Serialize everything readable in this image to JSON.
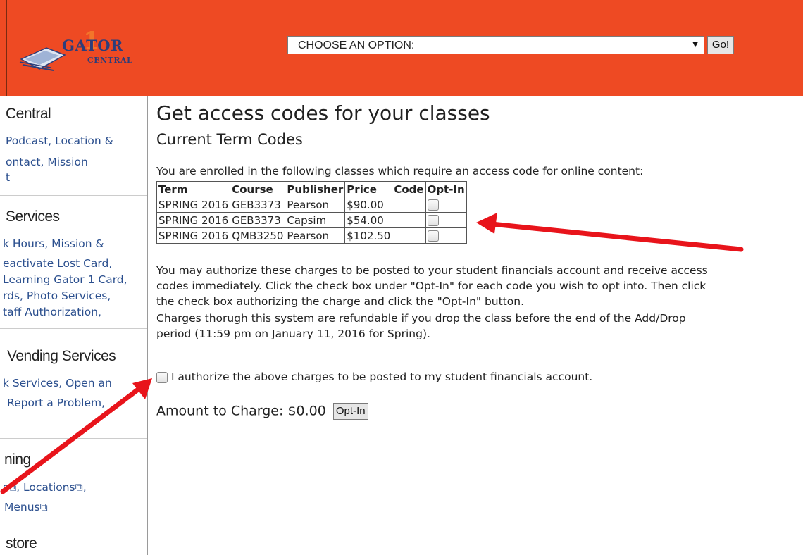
{
  "header": {
    "logo_line1": "GATOR",
    "logo_number": "1",
    "logo_line2": "CENTRAL",
    "select_value": "CHOOSE AN OPTION:",
    "go_label": "Go!",
    "bg_color": "#ee4a23"
  },
  "sidebar": {
    "sections": [
      {
        "title": "Central",
        "links": [
          "Podcast,  Location &",
          "ontact,  Mission",
          "t"
        ]
      },
      {
        "title": "Services",
        "links": [
          "k Hours,  Mission &",
          "eactivate Lost Card,",
          "Learning Gator 1 Card,",
          "rds,  Photo Services,",
          "taff Authorization,"
        ]
      },
      {
        "title": "Vending Services",
        "links": [
          "k Services,  Open an",
          "Report a Problem,"
        ]
      },
      {
        "title": "ning",
        "links": [
          "s⧉,  Locations⧉,",
          "Menus⧉"
        ]
      },
      {
        "title": "store",
        "links": []
      }
    ],
    "link_color": "#2b4f8e"
  },
  "main": {
    "title": "Get access codes for your classes",
    "subtitle": "Current Term Codes",
    "intro": "You are enrolled in the following classes which require an access code for online content:",
    "table": {
      "headers": [
        "Term",
        "Course",
        "Publisher",
        "Price",
        "Code",
        "Opt-In"
      ],
      "rows": [
        [
          "SPRING 2016",
          "GEB3373",
          "Pearson",
          "$90.00",
          ""
        ],
        [
          "SPRING 2016",
          "GEB3373",
          "Capsim",
          "$54.00",
          ""
        ],
        [
          "SPRING 2016",
          "QMB3250",
          "Pearson",
          "$102.50",
          ""
        ]
      ]
    },
    "para1_line1": "You may authorize these charges to be posted to your student financials account and receive access",
    "para1_line2": "codes immediately. Click the check box under \"Opt-In\" for each code you wish to opt into. Then click",
    "para1_line3": "the check box authorizing the charge and click the \"Opt-In\" button.",
    "para2_line1": "Charges thorugh this system are refundable if you drop the class before the end of the Add/Drop",
    "para2_line2": "period (11:59 pm on January 11, 2016 for Spring).",
    "authorize_label": "I authorize the above charges to be posted to my student financials account.",
    "amount_label": "Amount to Charge: $0.00",
    "optin_button": "Opt-In"
  },
  "annotations": {
    "arrow_color": "#e8141b"
  }
}
